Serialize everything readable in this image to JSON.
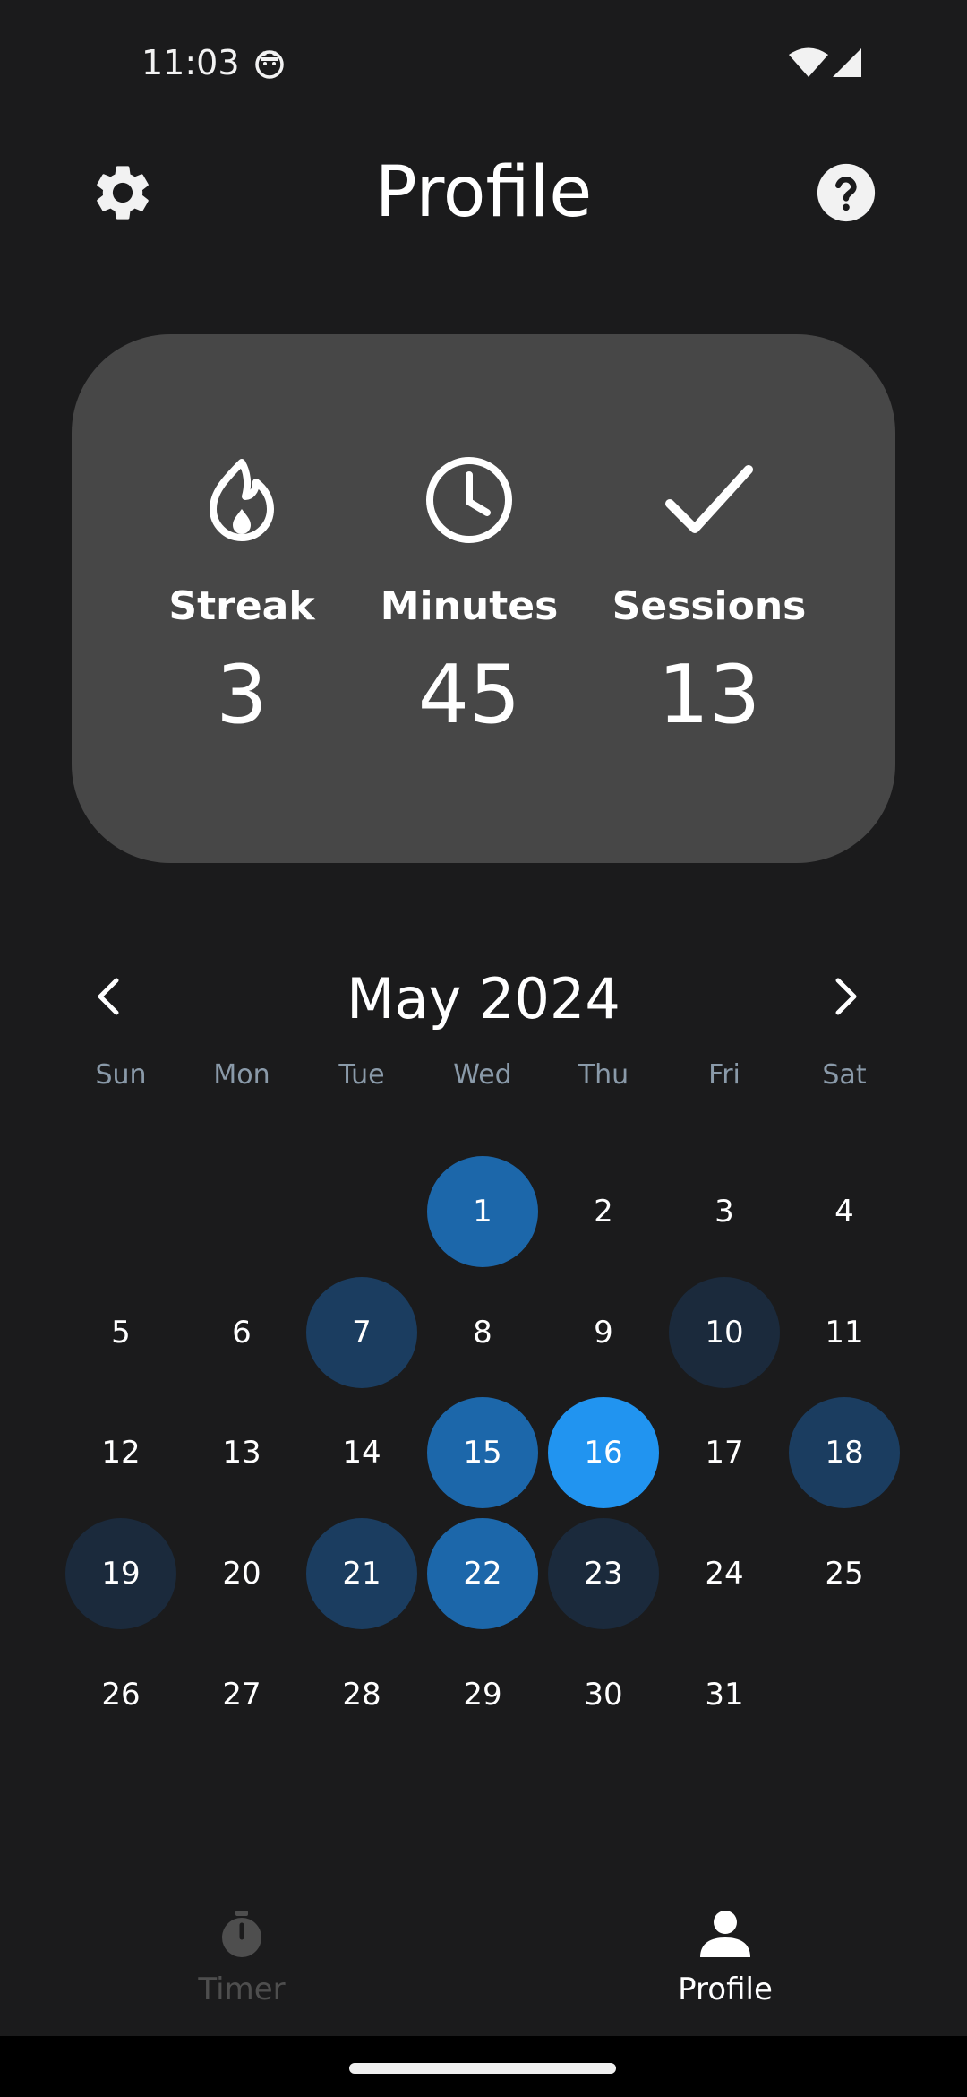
{
  "status_bar": {
    "time": "11:03"
  },
  "header": {
    "title": "Profile",
    "settings_icon": "gear-icon",
    "help_icon": "help-circle-icon"
  },
  "stats": [
    {
      "icon": "flame-icon",
      "label": "Streak",
      "value": "3"
    },
    {
      "icon": "clock-icon",
      "label": "Minutes",
      "value": "45"
    },
    {
      "icon": "check-icon",
      "label": "Sessions",
      "value": "13"
    }
  ],
  "calendar": {
    "month_label": "May 2024",
    "weekdays": [
      "Sun",
      "Mon",
      "Tue",
      "Wed",
      "Thu",
      "Fri",
      "Sat"
    ],
    "first_weekday_index": 3,
    "days_in_month": 31,
    "highlight_colors": {
      "light": "#1b2a3c",
      "medium": "#1b3d60",
      "strong": "#1c67aa",
      "today": "#2194f0"
    },
    "highlighted_days": {
      "1": "strong",
      "7": "medium",
      "10": "light",
      "15": "strong",
      "16": "today",
      "18": "medium",
      "19": "light",
      "21": "medium",
      "22": "strong",
      "23": "light"
    }
  },
  "bottom_nav": {
    "items": [
      {
        "label": "Timer",
        "icon": "stopwatch-icon",
        "active": false
      },
      {
        "label": "Profile",
        "icon": "person-icon",
        "active": true
      }
    ]
  }
}
